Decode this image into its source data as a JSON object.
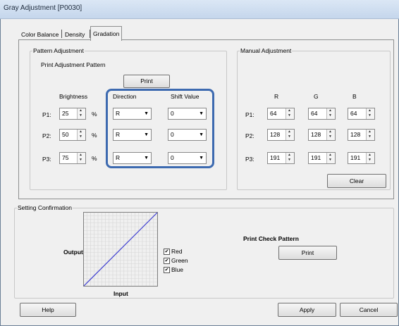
{
  "window": {
    "title": "Gray Adjustment [P0030]"
  },
  "tabs": [
    {
      "label": "Color Balance"
    },
    {
      "label": "Density"
    },
    {
      "label": "Gradation"
    }
  ],
  "pattern": {
    "group_label": "Pattern Adjustment",
    "print_label": "Print Adjustment Pattern",
    "print_button": "Print",
    "brightness_header": "Brightness",
    "direction_header": "Direction",
    "shift_header": "Shift Value",
    "percent": "%",
    "rows": [
      {
        "label": "P1:",
        "brightness": "25",
        "direction": "R",
        "shift": "0"
      },
      {
        "label": "P2:",
        "brightness": "50",
        "direction": "R",
        "shift": "0"
      },
      {
        "label": "P3:",
        "brightness": "75",
        "direction": "R",
        "shift": "0"
      }
    ]
  },
  "manual": {
    "group_label": "Manual Adjustment",
    "headers": [
      "R",
      "G",
      "B"
    ],
    "rows": [
      {
        "label": "P1:",
        "values": [
          "64",
          "64",
          "64"
        ]
      },
      {
        "label": "P2:",
        "values": [
          "128",
          "128",
          "128"
        ]
      },
      {
        "label": "P3:",
        "values": [
          "191",
          "191",
          "191"
        ]
      }
    ],
    "clear_button": "Clear"
  },
  "confirm": {
    "group_label": "Setting Confirmation",
    "output_label": "Output",
    "input_label": "Input",
    "checks": [
      {
        "label": "Red",
        "checked": true
      },
      {
        "label": "Green",
        "checked": true
      },
      {
        "label": "Blue",
        "checked": true
      }
    ],
    "check_mark": "✔",
    "print_check_label": "Print Check Pattern",
    "print_button": "Print"
  },
  "footer": {
    "help": "Help",
    "apply": "Apply",
    "cancel": "Cancel"
  },
  "colors": {
    "curve": "#3b3bd0",
    "highlight": "#3d6ab0"
  }
}
